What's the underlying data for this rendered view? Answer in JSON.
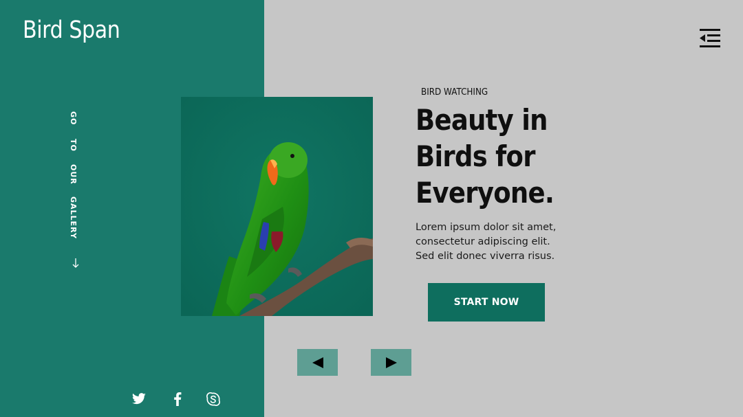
{
  "brand": {
    "name": "Bird Span"
  },
  "menu": {
    "icon": "menu-collapse-icon"
  },
  "side_nav": {
    "words": [
      "GO",
      "TO",
      "OUR",
      "GALLERY"
    ],
    "arrow_icon": "arrow-down-icon"
  },
  "hero": {
    "eyebrow": "BIRD WATCHING",
    "headline_lines": [
      "Beauty in",
      "Birds for",
      "Everyone."
    ],
    "body_lines": [
      "Lorem ipsum dolor sit amet,",
      "consectetur adipiscing elit.",
      "Sed elit donec viverra risus."
    ],
    "cta_label": "START NOW",
    "image": "green-parrot-photo"
  },
  "carousel": {
    "prev_icon": "triangle-left-icon",
    "next_icon": "triangle-right-icon"
  },
  "social": [
    "twitter-icon",
    "facebook-icon",
    "skype-icon"
  ],
  "colors": {
    "panel_teal": "#1a7a6c",
    "background_gray": "#c6c6c6",
    "button_teal": "#0e6e5e",
    "arrow_button": "#5e9e93"
  }
}
